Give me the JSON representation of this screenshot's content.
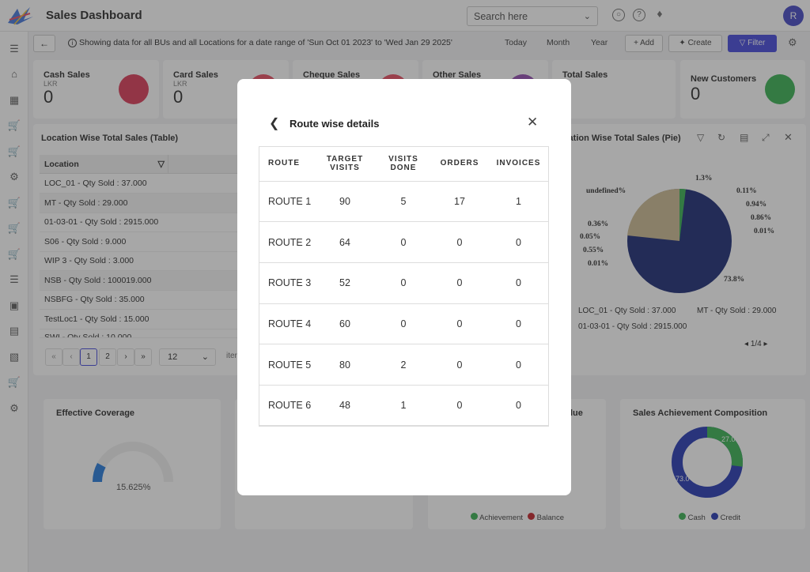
{
  "header": {
    "title": "Sales Dashboard",
    "search_placeholder": "Search here",
    "avatar_initial": "R"
  },
  "subbar": {
    "info": "Showing data for all BUs and all Locations for a date range of 'Sun Oct 01 2023' to 'Wed Jan 29 2025'",
    "today": "Today",
    "month": "Month",
    "year": "Year",
    "add": "+ Add",
    "create": "Create",
    "filter": "Filter"
  },
  "kpis": [
    {
      "title": "Cash Sales",
      "currency": "LKR",
      "value": "0",
      "color": "#d9304f"
    },
    {
      "title": "Card Sales",
      "currency": "LKR",
      "value": "0",
      "color": "#e8445a"
    },
    {
      "title": "Cheque Sales",
      "currency": "",
      "value": "",
      "color": "#e8445a"
    },
    {
      "title": "Other Sales",
      "currency": "",
      "value": "",
      "color": "#8e44ad"
    },
    {
      "title": "Total Sales",
      "currency": "",
      "value": "",
      "color": "#3b3fd9"
    },
    {
      "title": "New Customers",
      "currency": "",
      "value": "0",
      "color": "#2eae4a"
    }
  ],
  "location_table": {
    "title": "Location Wise Total Sales (Table)",
    "column": "Location",
    "rows": [
      "LOC_01 - Qty Sold : 37.000",
      "MT - Qty Sold : 29.000",
      "01-03-01 - Qty Sold : 2915.000",
      "S06 - Qty Sold : 9.000",
      "WIP 3 - Qty Sold : 3.000",
      "NSB - Qty Sold : 100019.000",
      "NSBFG - Qty Sold : 35.000",
      "TestLoc1 - Qty Sold : 15.000",
      "SWI - Qty Sold : 10.000"
    ],
    "pager": {
      "p1": "1",
      "p2": "2",
      "page_size": "12",
      "items_label": "iter"
    }
  },
  "pie_panel": {
    "title": "Location Wise Total Sales (Pie)",
    "labels": [
      "1.3%",
      "0.11%",
      "0.94%",
      "0.86%",
      "0.01%",
      "undefined%",
      "0.36%",
      "0.05%",
      "0.55%",
      "0.01%",
      "73.8%"
    ],
    "legend": [
      "LOC_01 - Qty Sold : 37.000",
      "MT - Qty Sold : 29.000",
      "01-03-01 - Qty Sold : 2915.000"
    ],
    "page_indicator": "1/4"
  },
  "bottom": {
    "coverage_title": "Effective Coverage",
    "coverage_value": "15.625%",
    "coverage_fraction": 0.15625,
    "value_title_fragment": "lue",
    "achievement_legend": [
      "Achievement",
      "Balance"
    ],
    "composition_title": "Sales Achievement Composition",
    "composition_labels": [
      "27.0",
      "73.0"
    ],
    "composition_legend": [
      "Cash",
      "Credit"
    ]
  },
  "modal": {
    "title": "Route wise details",
    "columns": [
      "ROUTE",
      "TARGET VISITS",
      "VISITS DONE",
      "ORDERS",
      "INVOICES"
    ],
    "rows": [
      {
        "route": "ROUTE 1",
        "target": "90",
        "done": "5",
        "orders": "17",
        "invoices": "1"
      },
      {
        "route": "ROUTE 2",
        "target": "64",
        "done": "0",
        "orders": "0",
        "invoices": "0"
      },
      {
        "route": "ROUTE 3",
        "target": "52",
        "done": "0",
        "orders": "0",
        "invoices": "0"
      },
      {
        "route": "ROUTE 4",
        "target": "60",
        "done": "0",
        "orders": "0",
        "invoices": "0"
      },
      {
        "route": "ROUTE 5",
        "target": "80",
        "done": "2",
        "orders": "0",
        "invoices": "0"
      },
      {
        "route": "ROUTE 6",
        "target": "48",
        "done": "1",
        "orders": "0",
        "invoices": "0"
      }
    ]
  }
}
